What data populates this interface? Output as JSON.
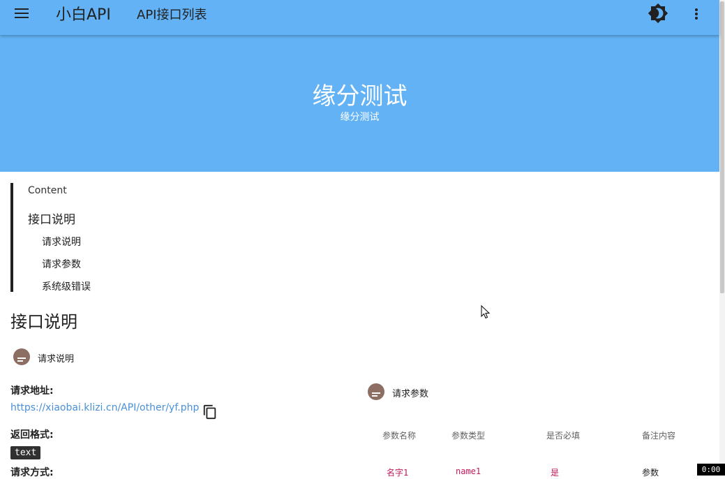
{
  "appbar": {
    "brand": "小白API",
    "page_name": "API接口列表"
  },
  "hero": {
    "title": "缘分测试",
    "subtitle": "缘分测试"
  },
  "toc": {
    "heading": "Content",
    "main_item": "接口说明",
    "sub_items": [
      "请求说明",
      "请求参数",
      "系统级错误"
    ]
  },
  "section": {
    "title": "接口说明"
  },
  "request_info": {
    "chip_label": "请求说明",
    "address_label": "请求地址:",
    "address_url": "https://xiaobai.klizi.cn/API/other/yf.php",
    "format_label": "返回格式:",
    "format_value": "text",
    "method_label": "请求方式:"
  },
  "params": {
    "chip_label": "请求参数",
    "columns": [
      "参数名称",
      "参数类型",
      "是否必填",
      "备注内容"
    ],
    "rows": [
      [
        "名字1",
        "name1",
        "是",
        "参数"
      ]
    ]
  },
  "video_timer": "0:00",
  "colors": {
    "appbar": "#62b2f5",
    "avatar": "#8d6e63",
    "link": "#4a90d9",
    "code_text": "#c2185b"
  },
  "icons": {
    "menu": "menu-icon",
    "theme": "brightness-icon",
    "more": "more-vert-icon",
    "copy": "copy-icon",
    "chip": "subject-icon"
  }
}
